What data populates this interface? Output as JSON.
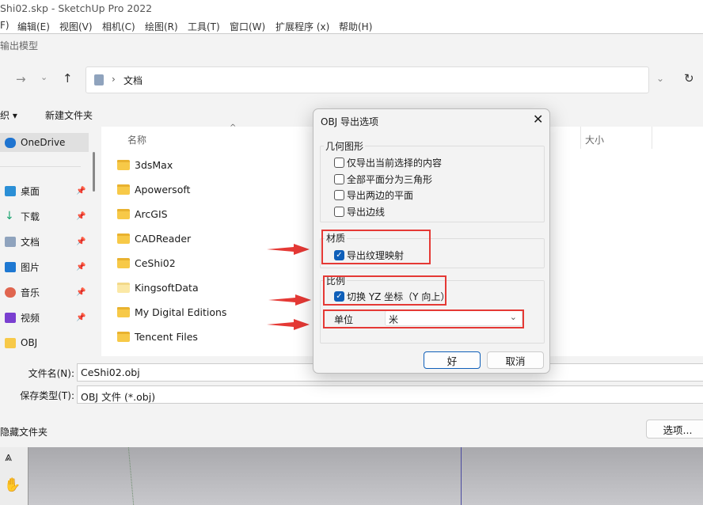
{
  "window": {
    "title": "Shi02.skp - SketchUp Pro 2022"
  },
  "menu": [
    "F)",
    "编辑(E)",
    "视图(V)",
    "相机(C)",
    "绘图(R)",
    "工具(T)",
    "窗口(W)",
    "扩展程序 (x)",
    "帮助(H)"
  ],
  "save_dialog": {
    "title": "输出模型",
    "breadcrumb": "文档",
    "organize": "织 ▾",
    "new_folder": "新建文件夹",
    "columns": {
      "name": "名称",
      "size": "大小"
    },
    "sidebar": [
      {
        "label": "OneDrive",
        "icon": "cloud-icon",
        "color": "#1f74d0"
      },
      {
        "label": "桌面",
        "icon": "desktop-icon",
        "color": "#2b8fd6",
        "pinned": true
      },
      {
        "label": "下载",
        "icon": "download-icon",
        "color": "#1aa36f",
        "pinned": true
      },
      {
        "label": "文档",
        "icon": "document-icon",
        "color": "#8fa3bd",
        "pinned": true
      },
      {
        "label": "图片",
        "icon": "pictures-icon",
        "color": "#1e78d2",
        "pinned": true
      },
      {
        "label": "音乐",
        "icon": "music-icon",
        "color": "#e0654f",
        "pinned": true
      },
      {
        "label": "视频",
        "icon": "video-icon",
        "color": "#7a3fd0",
        "pinned": true
      },
      {
        "label": "OBJ",
        "icon": "folder-icon",
        "color": "#f7c948"
      }
    ],
    "files": [
      "3dsMax",
      "Apowersoft",
      "ArcGIS",
      "CADReader",
      "CeShi02",
      "KingsoftData",
      "My Digital Editions",
      "Tencent Files"
    ],
    "filename_label": "文件名(N):",
    "filename": "CeShi02.obj",
    "type_label": "保存类型(T):",
    "type": "OBJ 文件 (*.obj)",
    "hide_folders": "隐藏文件夹",
    "options_button": "选项..."
  },
  "obj_dialog": {
    "title": "OBJ 导出选项",
    "geometry": {
      "title": "几何图形",
      "options": [
        {
          "label": "仅导出当前选择的内容",
          "checked": false
        },
        {
          "label": "全部平面分为三角形",
          "checked": false
        },
        {
          "label": "导出两边的平面",
          "checked": false
        },
        {
          "label": "导出边线",
          "checked": false
        }
      ]
    },
    "materials": {
      "title": "材质",
      "option": {
        "label": "导出纹理映射",
        "checked": true
      }
    },
    "scale": {
      "title": "比例",
      "option": {
        "label": "切换 YZ 坐标（Y 向上）",
        "checked": true
      },
      "unit_label": "单位",
      "unit_value": "米"
    },
    "ok": "好",
    "cancel": "取消"
  },
  "colors": {
    "highlight": "#e53935",
    "accent": "#0f5fb9"
  }
}
